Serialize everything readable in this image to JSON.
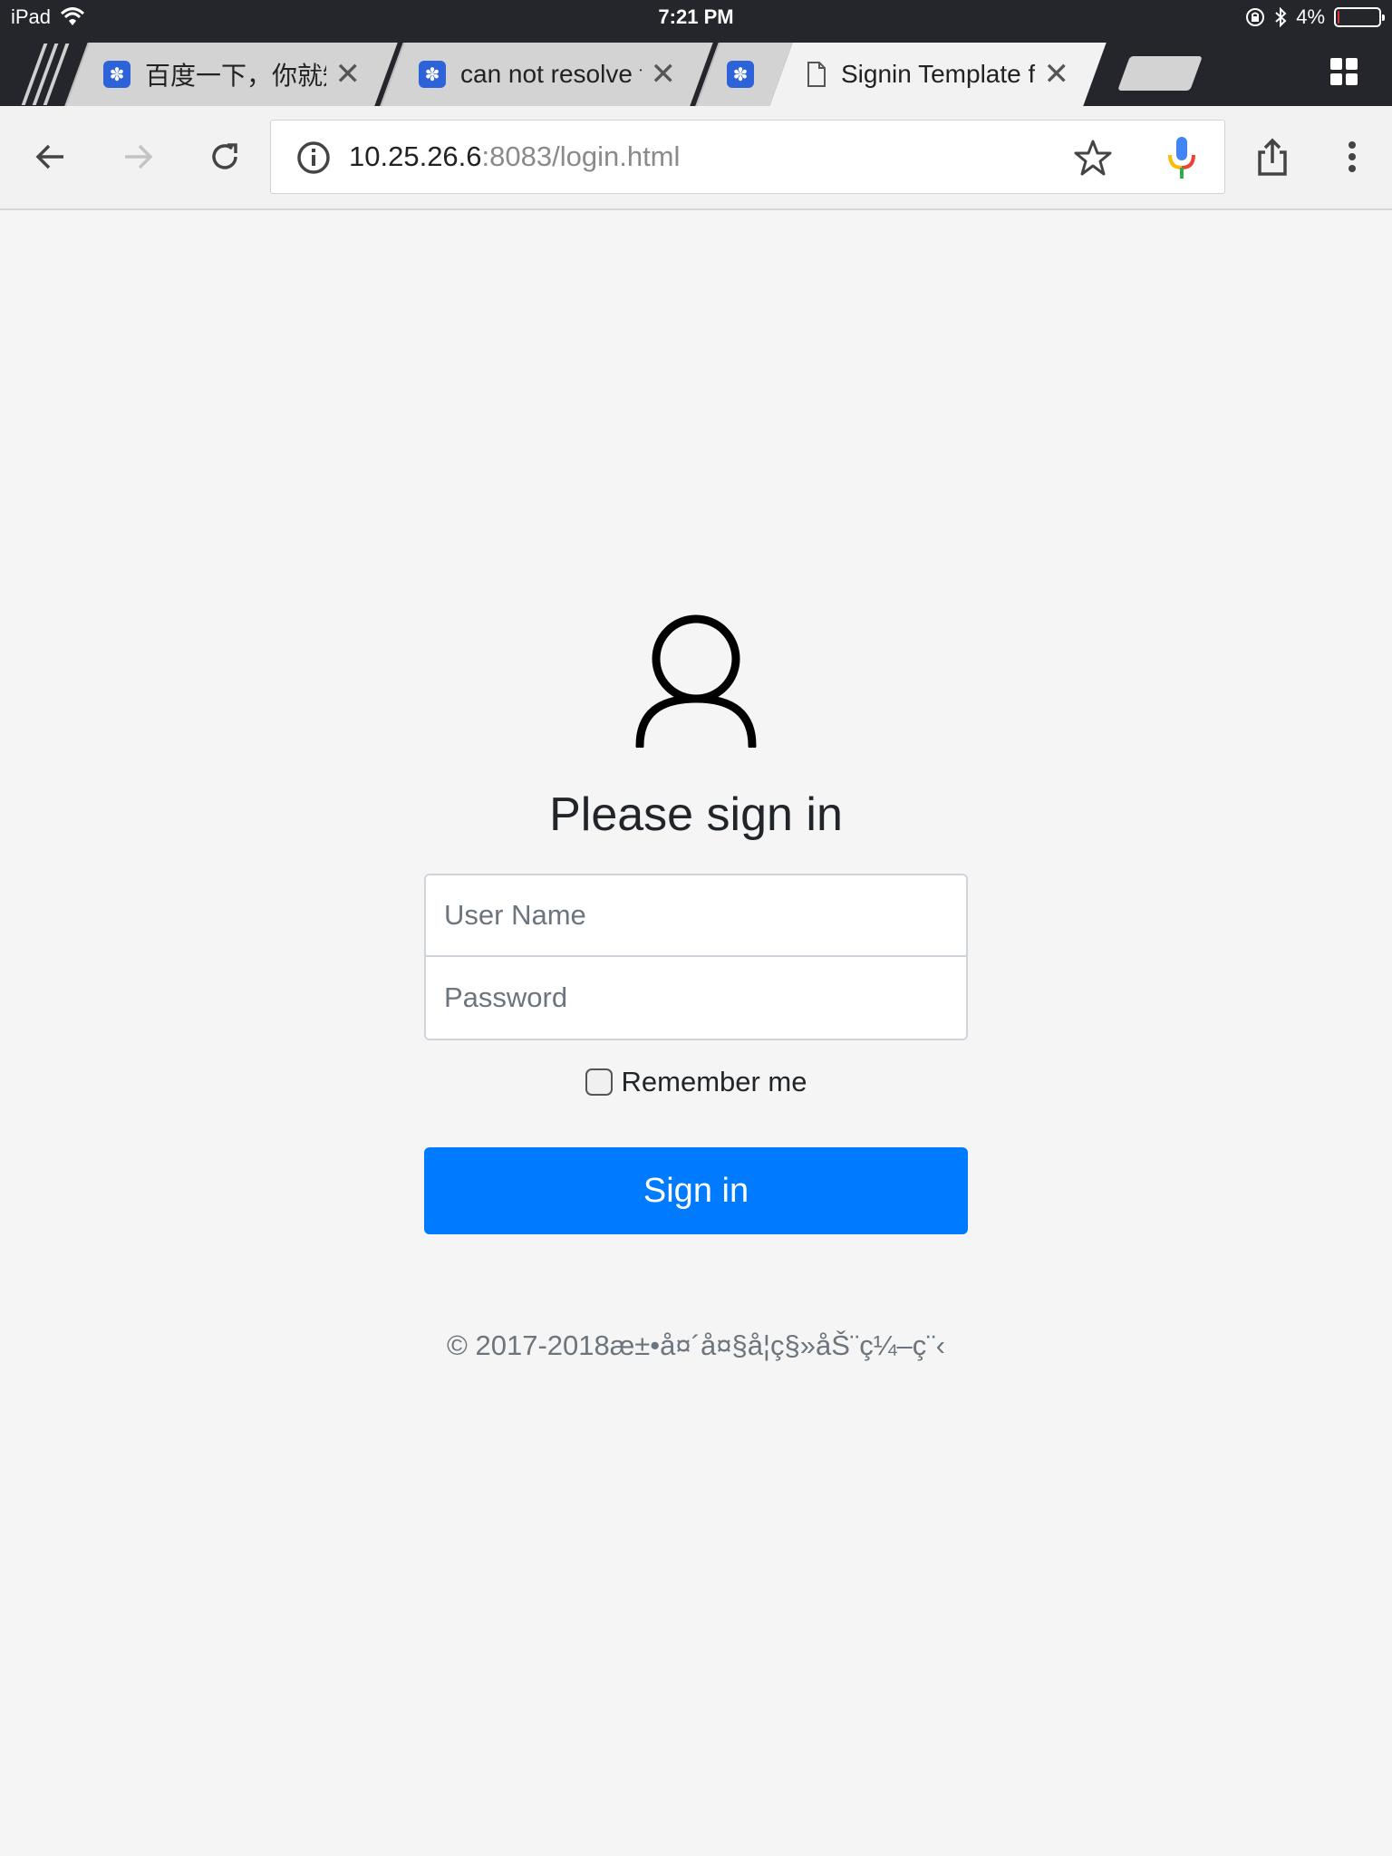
{
  "status_bar": {
    "device": "iPad",
    "time": "7:21 PM",
    "battery": "4%",
    "battery_level": 0.04
  },
  "tabs": [
    {
      "title": "百度一下，你就知",
      "favicon": "baidu-paw-icon",
      "active": false
    },
    {
      "title": "can not resolve fil",
      "favicon": "baidu-paw-icon",
      "active": false
    },
    {
      "title": "",
      "favicon": "baidu-paw-icon",
      "active": false
    },
    {
      "title": "Signin Template f",
      "favicon": "document-icon",
      "active": true
    }
  ],
  "toolbar": {
    "url_host": "10.25.26.6",
    "url_rest": ":8083/login.html"
  },
  "signin": {
    "heading": "Please sign in",
    "username_placeholder": "User Name",
    "password_placeholder": "Password",
    "remember_label": "Remember me",
    "submit_label": "Sign in",
    "footer": "© 2017-2018æ±•å¤´å¤§å¦ç§»åŠ¨ç¼–ç¨‹"
  },
  "colors": {
    "primary": "#007bff",
    "chrome_dark": "#25262b",
    "page_bg": "#f5f5f5"
  }
}
